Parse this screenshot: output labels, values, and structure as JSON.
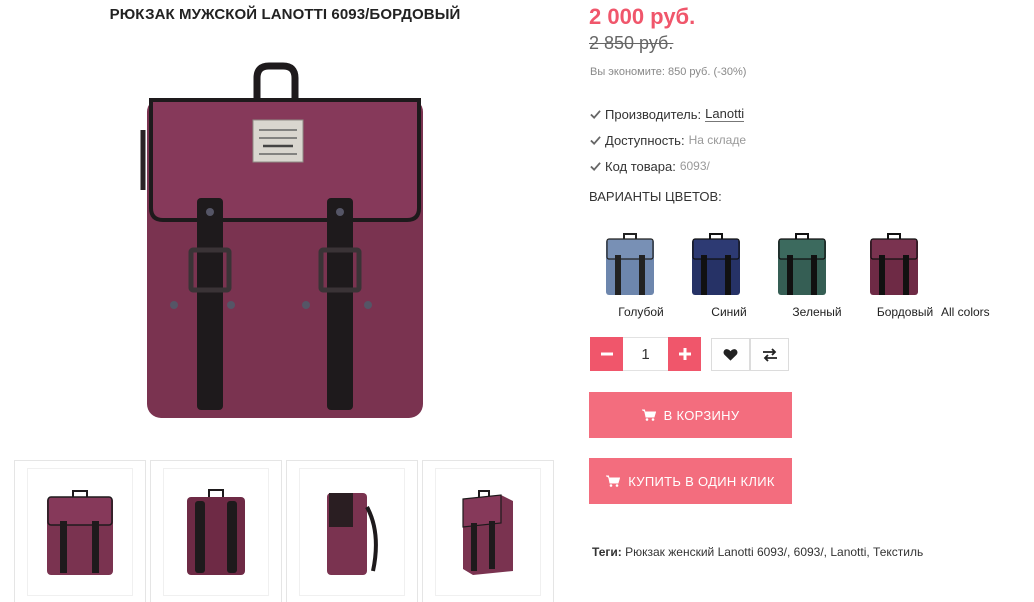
{
  "product": {
    "title": "РЮКЗАК МУЖСКОЙ LANOTTI 6093/БОРДОВЫЙ",
    "price": "2 000 руб.",
    "old_price": "2 850 руб.",
    "savings": "Вы экономите: 850 руб. (-30%)",
    "main_color": "#7a3350"
  },
  "meta": {
    "manufacturer_label": "Производитель:",
    "manufacturer_value": "Lanotti",
    "availability_label": "Доступность:",
    "availability_value": "На складе",
    "sku_label": "Код товара:",
    "sku_value": "6093/"
  },
  "variants": {
    "title": "ВАРИАНТЫ ЦВЕТОВ:",
    "items": [
      {
        "label": "Голубой",
        "color": "#6d86ad"
      },
      {
        "label": "Синий",
        "color": "#263266"
      },
      {
        "label": "Зеленый",
        "color": "#355e54"
      },
      {
        "label": "Бордовый",
        "color": "#6e2a45"
      }
    ],
    "all_colors": "All colors"
  },
  "quantity": {
    "value": "1"
  },
  "buttons": {
    "cart": "В КОРЗИНУ",
    "one_click": "КУПИТЬ В ОДИН КЛИК"
  },
  "tags": {
    "label": "Теги:",
    "value": " Рюкзак женский Lanotti 6093/, 6093/, Lanotti, Текстиль"
  },
  "colors": {
    "accent": "#f0566b",
    "button": "#f36d7e",
    "strap": "#1e1a1c"
  }
}
